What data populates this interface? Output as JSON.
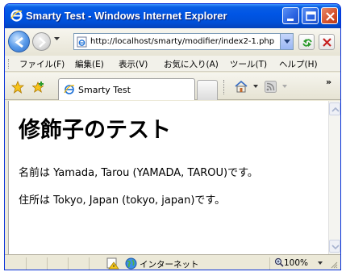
{
  "window": {
    "title": "Smarty Test - Windows Internet Explorer",
    "icon": "ie-icon",
    "controls": [
      "minimize-icon",
      "maximize-icon",
      "close-icon"
    ]
  },
  "navigation": {
    "url": "http://localhost/smarty/modifier/index2-1.php",
    "back_icon": "back-arrow-icon",
    "forward_icon": "forward-arrow-icon",
    "refresh_icon": "refresh-icon",
    "stop_icon": "stop-icon"
  },
  "menu": {
    "items": [
      {
        "label": "ファイル(F)"
      },
      {
        "label": "編集(E)"
      },
      {
        "label": "表示(V)"
      },
      {
        "label": "お気に入り(A)"
      },
      {
        "label": "ツール(T)"
      },
      {
        "label": "ヘルプ(H)"
      }
    ]
  },
  "tabs": {
    "active_label": "Smarty Test",
    "more": "»"
  },
  "page": {
    "heading": "修飾子のテスト",
    "name_line": "名前は Yamada, Tarou (YAMADA, TAROU)です。",
    "address_line": "住所は Tokyo, Japan (tokyo, japan)です。"
  },
  "status": {
    "zone": "インターネット",
    "zoom": "100%"
  },
  "colors": {
    "titlebar": "#0055e5",
    "close_button": "#d4502a",
    "chrome": "#ece9d8"
  }
}
